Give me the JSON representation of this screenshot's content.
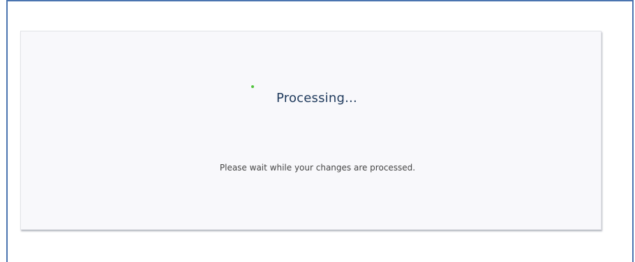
{
  "dialog": {
    "title": "Processing...",
    "message": "Please wait while your changes are processed."
  },
  "icons": {
    "spinner": "loading-spinner-icon"
  },
  "colors": {
    "frame_border": "#4a74b0",
    "title_text": "#1f3a5c",
    "spinner": "#4fc33a",
    "panel_background": "#f8f8fb"
  }
}
